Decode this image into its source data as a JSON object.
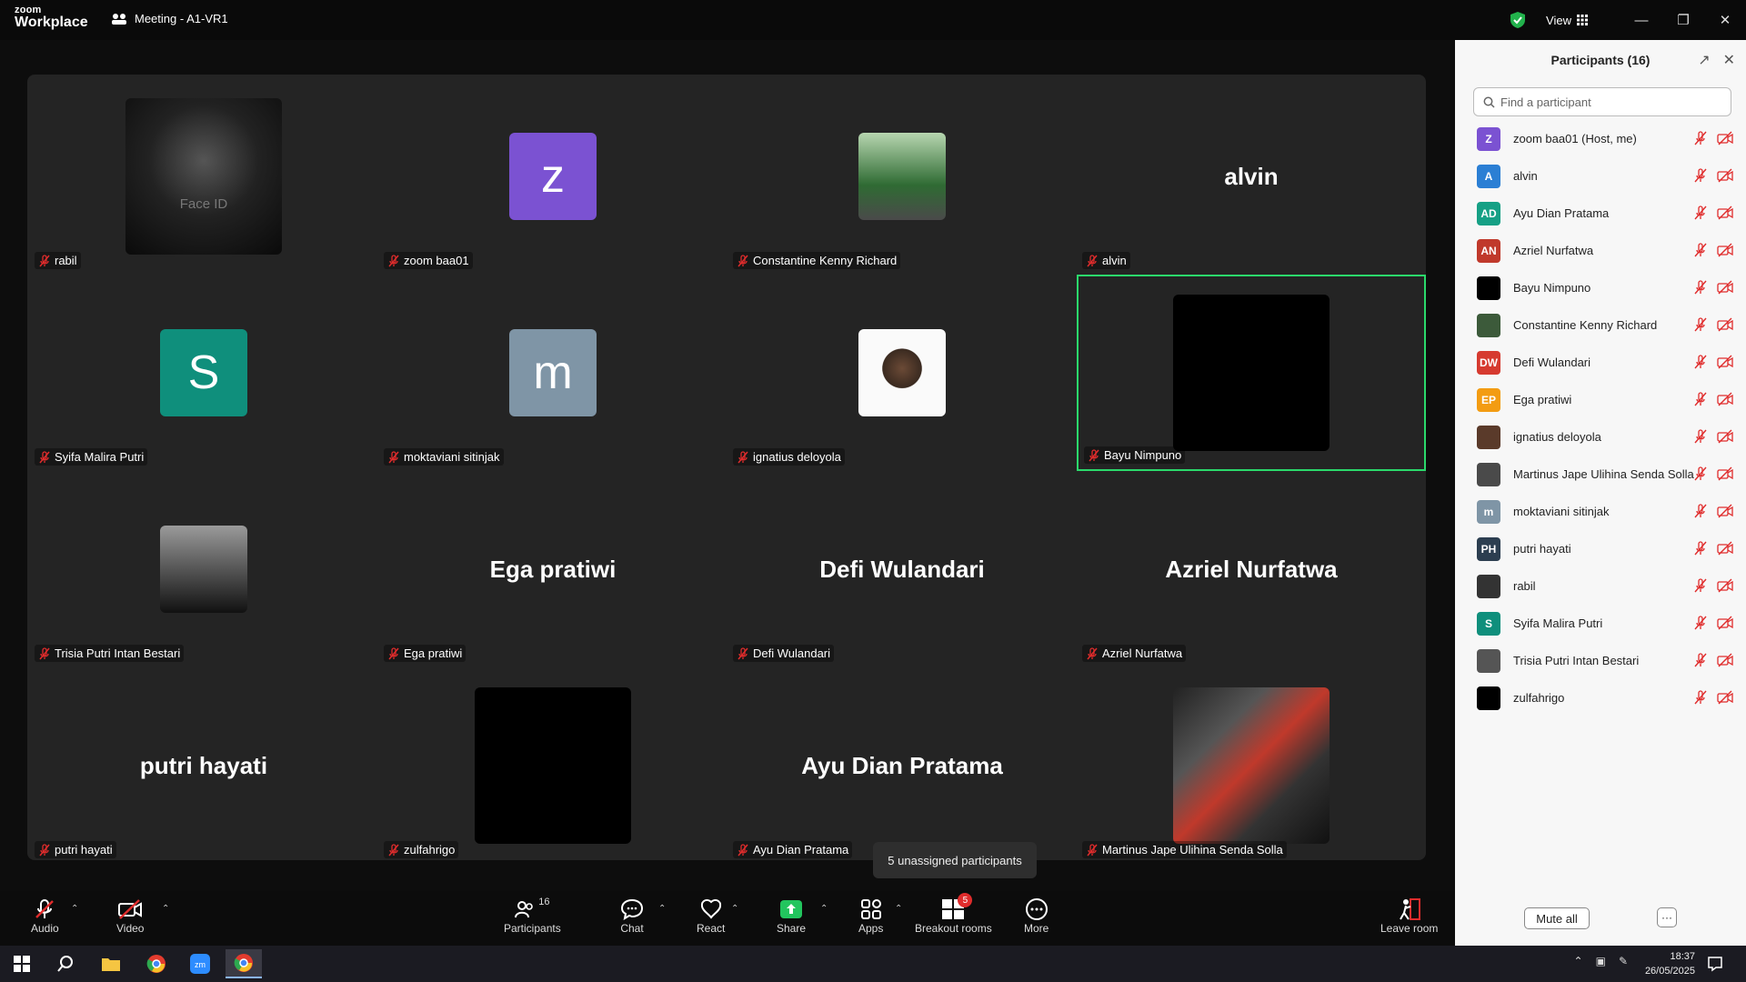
{
  "app": {
    "brand_top": "zoom",
    "brand_bottom": "Workplace",
    "meeting_title": "Meeting - A1-VR1",
    "view_label": "View"
  },
  "tiles": [
    {
      "name": "rabil",
      "kind": "photo",
      "overlay": "Face ID"
    },
    {
      "name": "zoom baa01",
      "kind": "avatar",
      "letter": "z",
      "color": "#7b52d2"
    },
    {
      "name": "Constantine Kenny Richard",
      "kind": "photo"
    },
    {
      "name": "alvin",
      "kind": "bigname",
      "display": "alvin"
    },
    {
      "name": "Syifa Malira Putri",
      "kind": "avatar",
      "letter": "S",
      "color": "#0f8f7c"
    },
    {
      "name": "moktaviani sitinjak",
      "kind": "avatar",
      "letter": "m",
      "color": "#7f95a6"
    },
    {
      "name": "ignatius deloyola",
      "kind": "photo"
    },
    {
      "name": "Bayu Nimpuno",
      "kind": "photo"
    },
    {
      "name": "Trisia Putri Intan Bestari",
      "kind": "photo"
    },
    {
      "name": "Ega pratiwi",
      "kind": "bigname",
      "display": "Ega pratiwi"
    },
    {
      "name": "Defi Wulandari",
      "kind": "bigname",
      "display": "Defi Wulandari"
    },
    {
      "name": "Azriel Nurfatwa",
      "kind": "bigname",
      "display": "Azriel Nurfatwa"
    },
    {
      "name": "putri hayati",
      "kind": "bigname",
      "display": "putri hayati"
    },
    {
      "name": "zulfahrigo",
      "kind": "photo"
    },
    {
      "name": "Ayu Dian Pratama",
      "kind": "bigname",
      "display": "Ayu Dian Pratama"
    },
    {
      "name": "Martinus Jape Ulihina Senda Solla",
      "kind": "photo"
    }
  ],
  "tooltip": "5 unassigned participants",
  "toolbar": {
    "audio": "Audio",
    "video": "Video",
    "participants": "Participants",
    "participants_count": "16",
    "chat": "Chat",
    "react": "React",
    "share": "Share",
    "apps": "Apps",
    "breakout": "Breakout rooms",
    "breakout_badge": "5",
    "more": "More",
    "leave": "Leave room"
  },
  "panel": {
    "title": "Participants (16)",
    "search_placeholder": "Find a participant",
    "mute_all": "Mute all",
    "more": "···",
    "participants": [
      {
        "initials": "Z",
        "name": "zoom baa01 (Host, me)",
        "color": "#7b52d2"
      },
      {
        "initials": "A",
        "name": "alvin",
        "color": "#2b7fd4"
      },
      {
        "initials": "AD",
        "name": "Ayu Dian Pratama",
        "color": "#16a085"
      },
      {
        "initials": "AN",
        "name": "Azriel Nurfatwa",
        "color": "#c0392b"
      },
      {
        "initials": "",
        "name": "Bayu Nimpuno",
        "color": "#000000"
      },
      {
        "initials": "",
        "name": "Constantine Kenny Richard",
        "color": "#3c5a3a"
      },
      {
        "initials": "DW",
        "name": "Defi Wulandari",
        "color": "#d63a2f"
      },
      {
        "initials": "EP",
        "name": "Ega pratiwi",
        "color": "#f39c12"
      },
      {
        "initials": "",
        "name": "ignatius deloyola",
        "color": "#5a3a2a"
      },
      {
        "initials": "",
        "name": "Martinus Jape Ulihina Senda Solla",
        "color": "#4a4a4a"
      },
      {
        "initials": "m",
        "name": "moktaviani sitinjak",
        "color": "#7f95a6"
      },
      {
        "initials": "PH",
        "name": "putri hayati",
        "color": "#2c3e50"
      },
      {
        "initials": "",
        "name": "rabil",
        "color": "#333333"
      },
      {
        "initials": "S",
        "name": "Syifa Malira Putri",
        "color": "#0f8f7c"
      },
      {
        "initials": "",
        "name": "Trisia Putri Intan Bestari",
        "color": "#555555"
      },
      {
        "initials": "",
        "name": "zulfahrigo",
        "color": "#000000"
      }
    ]
  },
  "taskbar": {
    "time": "18:37",
    "date": "26/05/2025"
  }
}
